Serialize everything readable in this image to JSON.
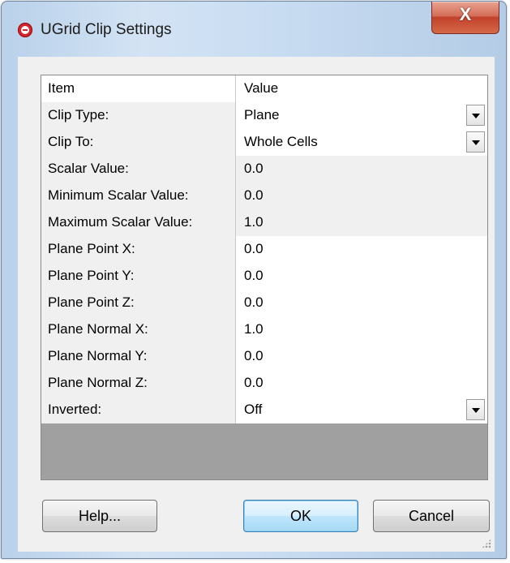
{
  "window": {
    "title": "UGrid Clip Settings",
    "app_icon": "ugrid-app-icon",
    "close_label": "X"
  },
  "grid": {
    "columns": [
      "Item",
      "Value"
    ],
    "rows": [
      {
        "item": "Clip Type:",
        "value": "Plane",
        "dropdown": true,
        "editable": true
      },
      {
        "item": "Clip To:",
        "value": "Whole Cells",
        "dropdown": true,
        "editable": true
      },
      {
        "item": "Scalar Value:",
        "value": "0.0",
        "dropdown": false,
        "editable": false
      },
      {
        "item": "Minimum Scalar Value:",
        "value": "0.0",
        "dropdown": false,
        "editable": false
      },
      {
        "item": "Maximum Scalar Value:",
        "value": "1.0",
        "dropdown": false,
        "editable": false
      },
      {
        "item": "Plane Point X:",
        "value": "0.0",
        "dropdown": false,
        "editable": true
      },
      {
        "item": "Plane Point Y:",
        "value": "0.0",
        "dropdown": false,
        "editable": true
      },
      {
        "item": "Plane Point Z:",
        "value": "0.0",
        "dropdown": false,
        "editable": true
      },
      {
        "item": "Plane Normal X:",
        "value": "1.0",
        "dropdown": false,
        "editable": true
      },
      {
        "item": "Plane Normal Y:",
        "value": "0.0",
        "dropdown": false,
        "editable": true
      },
      {
        "item": "Plane Normal Z:",
        "value": "0.0",
        "dropdown": false,
        "editable": true
      },
      {
        "item": "Inverted:",
        "value": "Off",
        "dropdown": true,
        "editable": true
      }
    ]
  },
  "buttons": {
    "help": "Help...",
    "ok": "OK",
    "cancel": "Cancel"
  },
  "colors": {
    "title_gradient": "#c8dcf1",
    "close_button": "#c2412b",
    "default_button": "#bee6fd",
    "readonly_cell": "#f0f0f0",
    "grid_empty": "#a0a0a0"
  }
}
